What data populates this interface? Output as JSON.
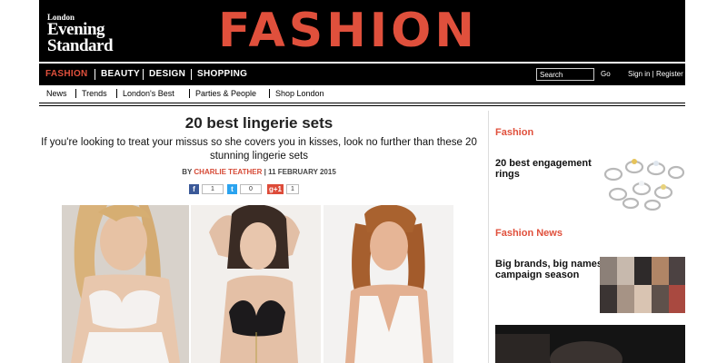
{
  "masthead": {
    "logo_line1": "London",
    "logo_line2": "Evening",
    "logo_line3": "Standard",
    "section_title": "FASHION",
    "accent_color": "#e0503c"
  },
  "nav": {
    "items": [
      "FASHION",
      "BEAUTY",
      "DESIGN",
      "SHOPPING"
    ],
    "active": "FASHION",
    "search_placeholder": "Search",
    "go_label": "Go",
    "signin_label": "Sign in | Register"
  },
  "subnav": {
    "items": [
      "News",
      "Trends",
      "London's Best",
      "Parties & People",
      "Shop London"
    ]
  },
  "article": {
    "headline": "20 best lingerie sets",
    "standfirst": "If you're looking to treat your missus so she covers you in kisses, look no further than these 20 stunning lingerie sets",
    "byline_prefix": "BY",
    "author": "CHARLIE TEATHER",
    "date": "| 11 FEBRUARY 2015",
    "share": {
      "facebook_icon": "f",
      "facebook_count": "1",
      "twitter_icon": "t",
      "twitter_count": "0",
      "gplus_icon": "g+1",
      "gplus_count": "1"
    }
  },
  "sidebar": {
    "section1_label": "Fashion",
    "section1_title": "20 best engagement rings",
    "section2_label": "Fashion News",
    "section2_title": "Big brands, big names: campaign season"
  }
}
